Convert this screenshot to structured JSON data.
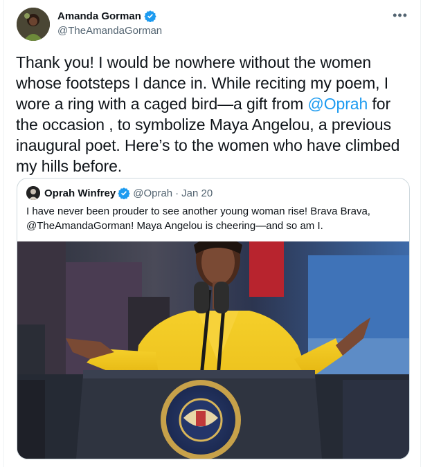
{
  "author": {
    "name": "Amanda Gorman",
    "handle": "@TheAmandaGorman"
  },
  "more_label": "•••",
  "tweet": {
    "text_before": "Thank you! I would be nowhere without the women whose footsteps I dance in. While reciting my poem, I wore a ring with a caged bird—a gift from ",
    "mention": "@Oprah",
    "text_after": " for the occasion , to symbolize Maya Angelou, a previous inaugural poet. Here’s to the women who have climbed my hills before."
  },
  "quote": {
    "name": "Oprah Winfrey",
    "handle": "@Oprah",
    "separator": "·",
    "date": "Jan 20",
    "text": "I have never been prouder to see another young woman rise! Brava Brava, @TheAmandaGorman! Maya Angelou is cheering—and so am I."
  },
  "colors": {
    "accent": "#1d9bf0",
    "coat": "#f2c51c"
  }
}
